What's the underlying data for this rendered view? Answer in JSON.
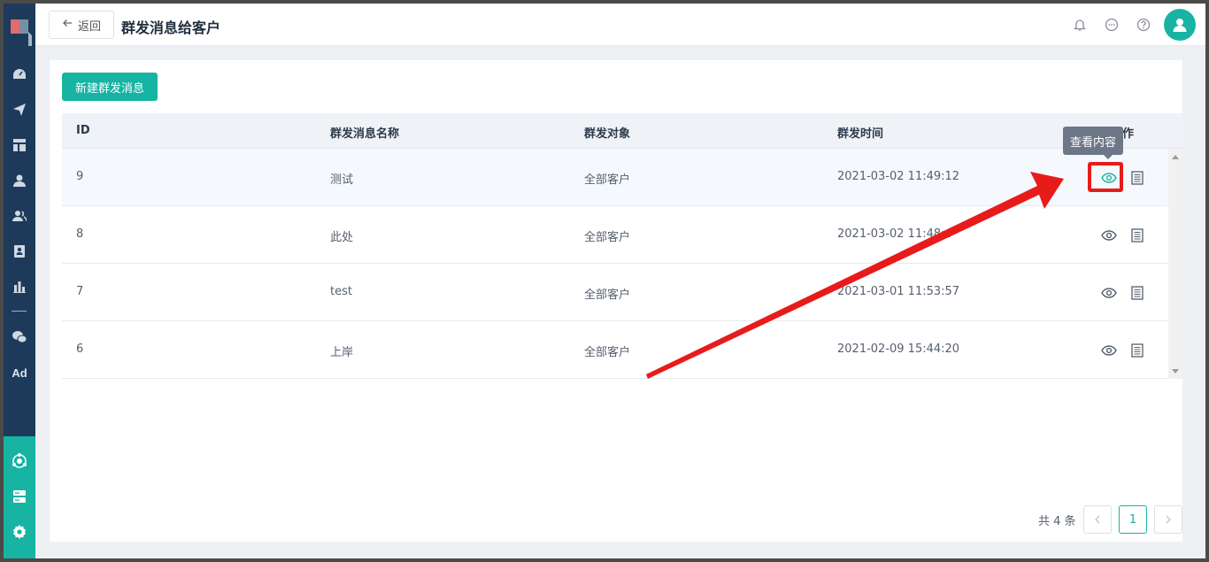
{
  "header": {
    "back_label": "返回",
    "title": "群发消息给客户"
  },
  "toolbar": {
    "new_label": "新建群发消息"
  },
  "table": {
    "columns": [
      "ID",
      "群发消息名称",
      "群发对象",
      "群发时间",
      "作"
    ],
    "rows": [
      {
        "id": "9",
        "name": "测试",
        "target": "全部客户",
        "time": "2021-03-02 11:49:12"
      },
      {
        "id": "8",
        "name": "此处",
        "target": "全部客户",
        "time": "2021-03-02 11:48:4"
      },
      {
        "id": "7",
        "name": "test",
        "target": "全部客户",
        "time": "2021-03-01 11:53:57"
      },
      {
        "id": "6",
        "name": "上岸",
        "target": "全部客户",
        "time": "2021-02-09 15:44:20"
      }
    ]
  },
  "tooltip": {
    "text": "查看内容"
  },
  "pagination": {
    "total": "共 4 条",
    "current": "1"
  },
  "sidebar": {
    "ad_label": "Ad"
  },
  "colors": {
    "accent": "#17b3a3",
    "sidebar": "#1d3a5a",
    "highlight": "#e81b1b"
  }
}
